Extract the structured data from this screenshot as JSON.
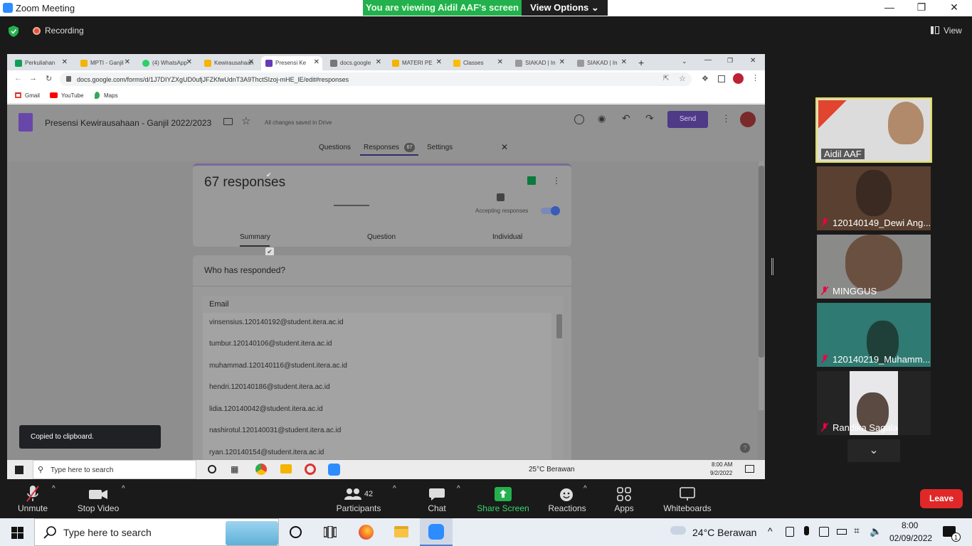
{
  "app": {
    "title": "Zoom Meeting"
  },
  "banner": {
    "viewing": "You are viewing Aidil AAF's screen",
    "view_options": "View Options"
  },
  "recording": {
    "label": "Recording",
    "view": "View"
  },
  "browser": {
    "tabs": [
      {
        "label": "Perkuliahan",
        "color": "#0f9d58"
      },
      {
        "label": "MPTI - Ganjil",
        "color": "#f4b400"
      },
      {
        "label": "(4) WhatsApp",
        "color": "#25d366"
      },
      {
        "label": "Kewirausahaan",
        "color": "#f4b400"
      },
      {
        "label": "Presensi Ke",
        "color": "#673ab7"
      },
      {
        "label": "docs.google",
        "color": "#777777"
      },
      {
        "label": "MATERI PE",
        "color": "#f4b400"
      },
      {
        "label": "Classes",
        "color": "#fbbc04"
      },
      {
        "label": "SIAKAD | In",
        "color": "#999999"
      },
      {
        "label": "SIAKAD | In",
        "color": "#999999"
      }
    ],
    "url": "docs.google.com/forms/d/1J7DIYZXgUD0ufjJFZKfwUdnT3A9ThctSIzoj-mHE_lE/edit#responses",
    "bookmarks": [
      "Gmail",
      "YouTube",
      "Maps"
    ]
  },
  "form": {
    "title": "Presensi Kewirausahaan - Ganjil 2022/2023",
    "saved": "All changes saved in Drive",
    "send": "Send",
    "nav": {
      "questions": "Questions",
      "responses": "Responses",
      "count": "67",
      "settings": "Settings"
    },
    "responses_title": "67 responses",
    "accepting": "Accepting responses",
    "subtabs": {
      "summary": "Summary",
      "question": "Question",
      "individual": "Individual"
    },
    "who": "Who has responded?",
    "email_header": "Email",
    "emails": [
      "vinsensius.120140192@student.itera.ac.id",
      "tumbur.120140106@student.itera.ac.id",
      "muhammad.120140116@student.itera.ac.id",
      "hendri.120140186@student.itera.ac.id",
      "lidia.120140042@student.itera.ac.id",
      "nashirotul.120140031@student.itera.ac.id",
      "ryan.120140154@student.itera.ac.id"
    ]
  },
  "toast": "Copied to clipboard.",
  "inner_taskbar": {
    "search": "Type here to search",
    "weather": "25°C  Berawan",
    "time": "8:00 AM",
    "date": "9/2/2022"
  },
  "participants": [
    {
      "name": "Aidil AAF"
    },
    {
      "name": "120140149_Dewi Ang..."
    },
    {
      "name": "MINGGUS"
    },
    {
      "name": "120140219_Muhamm..."
    },
    {
      "name": "Randika Sagala"
    }
  ],
  "controls": {
    "unmute": "Unmute",
    "stop_video": "Stop Video",
    "participants": "Participants",
    "participants_count": "42",
    "chat": "Chat",
    "share": "Share Screen",
    "reactions": "Reactions",
    "apps": "Apps",
    "whiteboards": "Whiteboards",
    "leave": "Leave"
  },
  "taskbar": {
    "search": "Type here to search",
    "weather": "24°C  Berawan",
    "time": "8:00",
    "date": "02/09/2022",
    "notif": "1"
  }
}
